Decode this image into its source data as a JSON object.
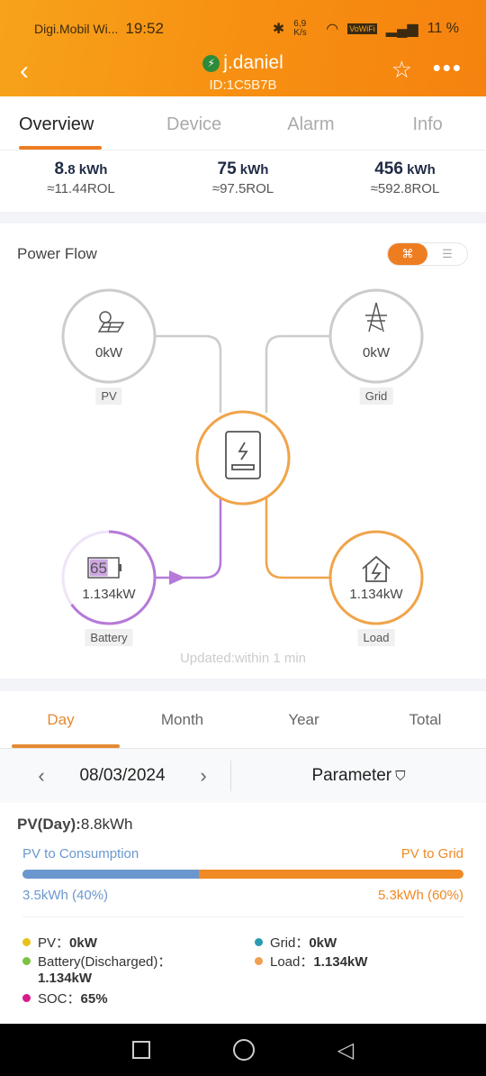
{
  "status": {
    "carrier": "Digi.Mobil Wi...",
    "time": "19:52",
    "speed": "6,9 K/s",
    "vowifi": "VoWiFi",
    "battery": "11 %"
  },
  "header": {
    "title": "j.daniel",
    "id": "ID:1C5B7B",
    "brand": "#f79012"
  },
  "tabs": [
    {
      "label": "Overview"
    },
    {
      "label": "Device"
    },
    {
      "label": "Alarm"
    },
    {
      "label": "Info"
    }
  ],
  "stats": [
    {
      "big": "8",
      "unit": ".8 kWh",
      "cost": "≈11.44ROL"
    },
    {
      "big": "75",
      "unit": " kWh",
      "cost": "≈97.5ROL"
    },
    {
      "big": "456",
      "unit": " kWh",
      "cost": "≈592.8ROL"
    }
  ],
  "power_flow": {
    "title": "Power Flow",
    "pv": {
      "value": "0kW",
      "label": "PV"
    },
    "grid": {
      "value": "0kW",
      "label": "Grid"
    },
    "battery": {
      "value": "1.134kW",
      "label": "Battery",
      "soc": "65",
      "soc_fraction": 0.65
    },
    "load": {
      "value": "1.134kW",
      "label": "Load"
    },
    "updated": "Updated:within 1 min"
  },
  "period_tabs": [
    {
      "label": "Day"
    },
    {
      "label": "Month"
    },
    {
      "label": "Year"
    },
    {
      "label": "Total"
    }
  ],
  "date": {
    "value": "08/03/2024",
    "parameter": "Parameter"
  },
  "summary": {
    "title_bold": "PV(Day):",
    "title_value": "8.8kWh",
    "left_label": "PV to Consumption",
    "right_label": "PV to Grid",
    "left_value": "3.5kWh (40%)",
    "right_value": "5.3kWh (60%)",
    "left_percent": 40
  },
  "readings": [
    {
      "label": "PV：",
      "value": "0kW",
      "color": "#e8c21a"
    },
    {
      "label": "Grid：",
      "value": "0kW",
      "color": "#2a9bb0"
    },
    {
      "label": "Battery(Discharged)：",
      "value": "1.134kW",
      "color": "#7cc242"
    },
    {
      "label": "Load：",
      "value": "1.134kW",
      "color": "#f0a050"
    },
    {
      "label": "SOC：",
      "value": "65%",
      "color": "#d81b8c"
    }
  ]
}
